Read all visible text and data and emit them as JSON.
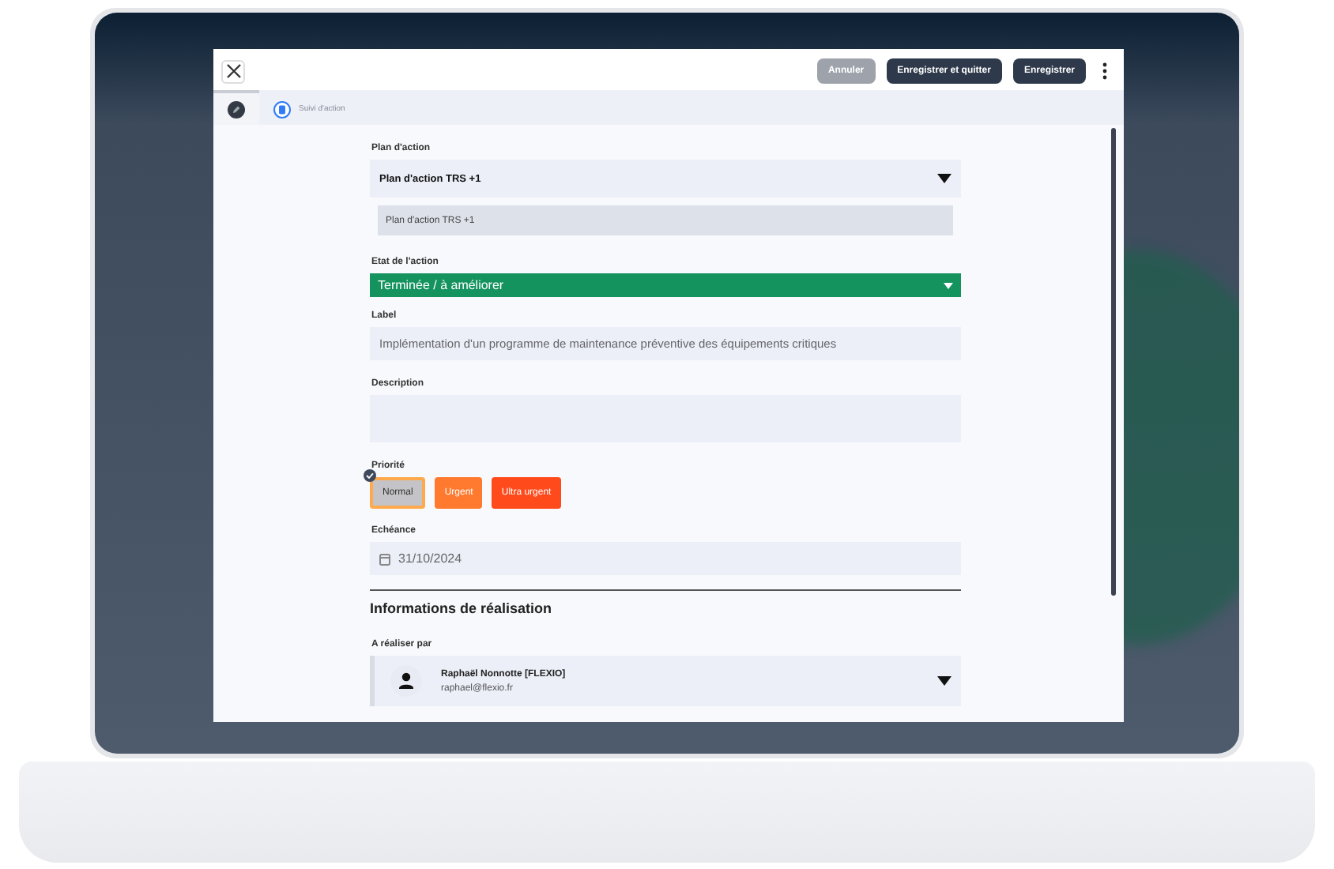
{
  "toolbar": {
    "buttons": [
      {
        "label": "Annuler",
        "disabled": true
      },
      {
        "label": "Enregistrer et quitter",
        "disabled": false
      },
      {
        "label": "Enregistrer",
        "disabled": false
      }
    ]
  },
  "tabs": [
    {
      "kind": "icon",
      "selected": true
    },
    {
      "kind": "labeled",
      "label": "Suivi d'action",
      "selected": false
    }
  ],
  "form": {
    "plan": {
      "label": "Plan d'action",
      "value": "Plan d'action TRS +1",
      "detail": "Plan d'action TRS +1"
    },
    "state": {
      "label": "Etat de l'action",
      "value": "Terminée / à améliorer",
      "color": "#14935f"
    },
    "label_field": {
      "label": "Label",
      "value": "Implémentation d'un programme de maintenance préventive des équipements critiques"
    },
    "description": {
      "label": "Description"
    },
    "priority": {
      "label": "Priorité",
      "options": [
        {
          "label": "Normal",
          "color": "#c4c4c8",
          "selected": true
        },
        {
          "label": "Urgent",
          "color": "#ff7a2e",
          "selected": false
        },
        {
          "label": "Ultra urgent",
          "color": "#ff4a1c",
          "selected": false
        }
      ]
    },
    "due": {
      "label": "Echéance",
      "value": "31/10/2024"
    },
    "section_title": "Informations de réalisation",
    "assignee": {
      "label": "A réaliser par",
      "name": "Raphaël Nonnotte [FLEXIO]",
      "email": "raphael@flexio.fr"
    }
  }
}
